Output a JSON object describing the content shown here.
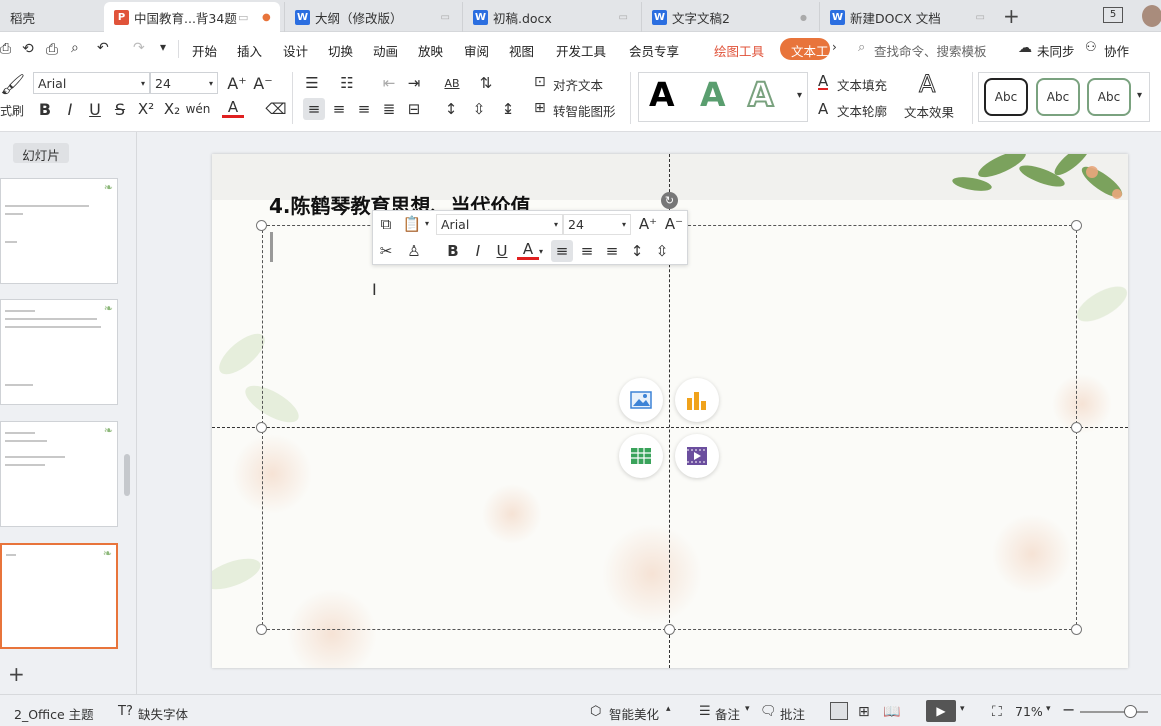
{
  "tabs": [
    {
      "label": "稻壳"
    },
    {
      "label": "中国教育...背34题",
      "icon": "P",
      "color": "#e0533a",
      "active": true
    },
    {
      "label": "大纲（修改版）",
      "icon": "W",
      "color": "#2b6ee0"
    },
    {
      "label": "初稿.docx",
      "icon": "W",
      "color": "#2b6ee0"
    },
    {
      "label": "文字文稿2",
      "icon": "W",
      "color": "#2b6ee0"
    },
    {
      "label": "新建DOCX 文档",
      "icon": "W",
      "color": "#2b6ee0"
    }
  ],
  "tab_new": "+",
  "window_count": "5",
  "menu": {
    "items": [
      "开始",
      "插入",
      "设计",
      "切换",
      "动画",
      "放映",
      "审阅",
      "视图",
      "开发工具",
      "会员专享"
    ],
    "drawing_tool": "绘图工具",
    "text_tool": "文本工",
    "search_placeholder": "查找命令、搜索模板",
    "sync": "未同步",
    "collab": "协作"
  },
  "toolbar": {
    "font_name": "Arial",
    "font_size": "24",
    "format_painter": "式刷",
    "align_text": "对齐文本",
    "smart_shape": "转智能图形",
    "text_fill": "文本填充",
    "text_outline": "文本轮廓",
    "text_effect": "文本效果",
    "style_sample": "Abc",
    "wordart": [
      "A",
      "A",
      "A"
    ]
  },
  "panel": {
    "tab": "幻灯片",
    "add": "+"
  },
  "slide": {
    "title": "4.陈鹤琴教育思想、当代价值"
  },
  "floating": {
    "font_name": "Arial",
    "font_size": "24"
  },
  "status": {
    "theme": "2_Office 主题",
    "missing_font": "缺失字体",
    "beautify": "智能美化",
    "notes": "备注",
    "comment": "批注",
    "zoom": "71%"
  },
  "colors": {
    "accent": "#e8743b",
    "font_color": "#e02020",
    "selection_border": "#555555"
  }
}
